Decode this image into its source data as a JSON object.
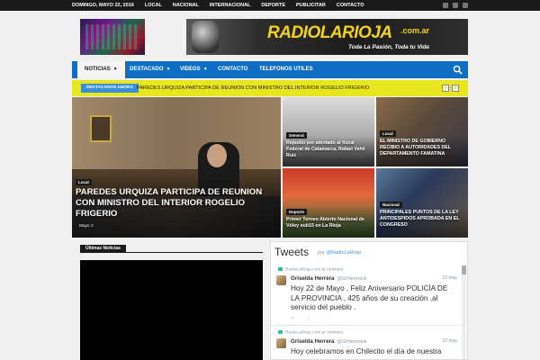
{
  "topbar": {
    "items": [
      "DOMINGO, MAYO 22, 2016",
      "LOCAL",
      "NACIONAL",
      "INTERNACIONAL",
      "DEPORTE",
      "PUBLICITAR",
      "CONTACTO"
    ]
  },
  "banner": {
    "brand": "RADIOLARIOJA",
    "suffix": ".com.ar",
    "tagline": "Toda La Pasión, Toda tu Vida"
  },
  "nav": {
    "items": [
      {
        "label": "NOTICIAS",
        "caret": "▼"
      },
      {
        "label": "DESTACADO",
        "caret": "▼"
      },
      {
        "label": "VIDEOS",
        "caret": "▼"
      },
      {
        "label": "CONTACTO",
        "caret": ""
      },
      {
        "label": "TELEFONOS UTILES",
        "caret": ""
      }
    ]
  },
  "ticker": {
    "label": "DESTACADOS AHORA",
    "text": "PAREDES URQUIZA PARTICIPA DE REUNION CON MINISTRO DEL INTERIOR ROGELIO FRIGERIO",
    "prev": "‹",
    "next": "›"
  },
  "featured": {
    "main": {
      "category": "Local",
      "title": "PAREDES URQUIZA PARTICIPA DE REUNION CON MINISTRO DEL INTERIOR ROGELIO FRIGERIO",
      "date": "Mayo 2"
    },
    "a": {
      "category": "General",
      "title": "Repudio por atentado al fiscal Federal de Catamarca, Rafael Vehil Ruiz"
    },
    "b": {
      "category": "Local",
      "title": "EL MINISTRO DE GOBIERNO RECIBIO A AUTORIDADES DEL DEPARTAMENTO FAMATINA"
    },
    "c": {
      "category": "Deporte",
      "title": "Primer Torneo Abierto Nacional de Vóley sub15 en La Rioja"
    },
    "d": {
      "category": "Nacional",
      "title": "PRINCIPALES PUNTOS DE LA LEY ANTIDESPIDOS APROBADA EN EL CONGRESO"
    }
  },
  "latest": {
    "label": "Últimas Noticias"
  },
  "twitter": {
    "heading": "Tweets",
    "by_prefix": "por",
    "by_handle": "@RadioLaRioja",
    "tweets": [
      {
        "retweet": "RadioLaRioja.com.ar retwitteó",
        "name": "Griselda Herrera",
        "handle": "@GrHerreraok",
        "date": "22 may.",
        "body": "Hoy 22 de Mayo , Feliz Aniversario POLICÍA DE LA PROVINCIA , 425 años de su creación ,al servicio del  pueblo ."
      },
      {
        "retweet": "RadioLaRioja.com.ar retwitteó",
        "name": "Griselda Herrera",
        "handle": "@GrHerreraok",
        "date": "22 may.",
        "body": "Hoy  celebramos en Chilecito el día de nuestra"
      }
    ]
  }
}
